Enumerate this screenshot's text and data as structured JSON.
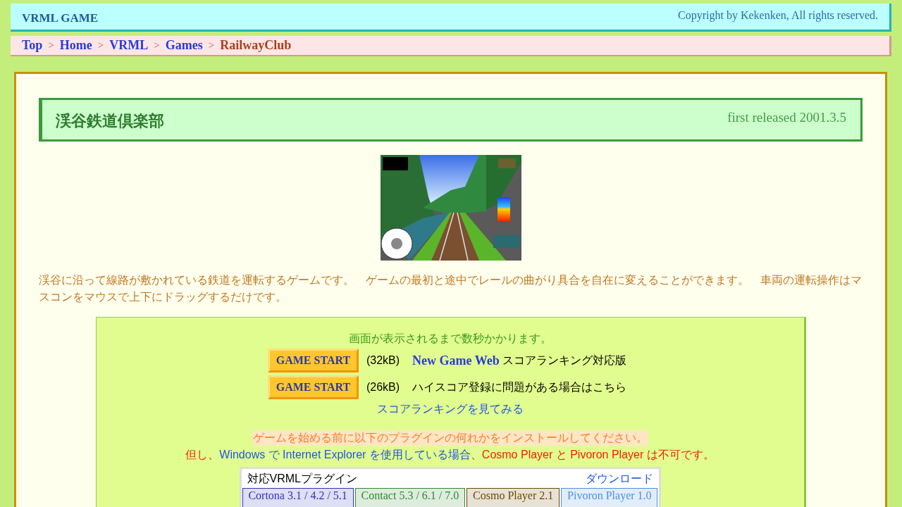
{
  "header": {
    "site_title": "VRML GAME",
    "copyright": "Copyright by Kekenken, All rights reserved."
  },
  "breadcrumbs": [
    {
      "label": "Top",
      "current": false
    },
    {
      "separator": ">",
      "label": "Home",
      "current": false
    },
    {
      "separator": ">",
      "label": "VRML",
      "current": false
    },
    {
      "separator": ">",
      "label": "Games",
      "current": false
    },
    {
      "separator": ">",
      "label": "RailwayClub",
      "current": true
    }
  ],
  "page": {
    "title": "渓谷鉄道倶楽部",
    "released": "first released 2001.3.5",
    "description": "渓谷に沿って線路が敷かれている鉄道を運転するゲームです。　ゲームの最初と途中でレールの曲がり具合を自在に変えることができます。　車両の運転操作はマスコンをマウスで上下にドラッグするだけです。"
  },
  "launch_box": {
    "notice": "画面が表示されるまで数秒かかります。",
    "launchers": [
      {
        "button": "GAME START",
        "size": "(32kB)",
        "link": "New Game Web",
        "note": "スコアランキング対応版"
      },
      {
        "button": "GAME START",
        "size": "(26kB)",
        "note": "ハイスコア登録に問題がある場合はこちら"
      }
    ],
    "ranking_link": "スコアランキングを見てみる",
    "install_notice": "ゲームを始める前に以下のプラグインの何れかをインストールしてください。",
    "caveat": [
      {
        "kind": "warning",
        "text": "但し、"
      },
      {
        "kind": "condition",
        "text": "Windows で Internet Explorer を使用している場合"
      },
      {
        "kind": "warning",
        "text": "、Cosmo Player と Pivoron Player は不可です。"
      }
    ],
    "plugin_table": {
      "heading": "対応VRMLプラグイン",
      "download": "ダウンロード",
      "plugins": [
        {
          "name": "Cortona 3.1 / 4.2 / 5.1",
          "color": "#3333bb"
        },
        {
          "name": "Contact 5.3 / 6.1 / 7.0",
          "color": "#2e8b2e"
        },
        {
          "name": "Cosmo Player 2.1",
          "color": "#6b4a00"
        },
        {
          "name": "Pivoron Player 1.0",
          "color": "#4a90e0"
        }
      ]
    }
  }
}
